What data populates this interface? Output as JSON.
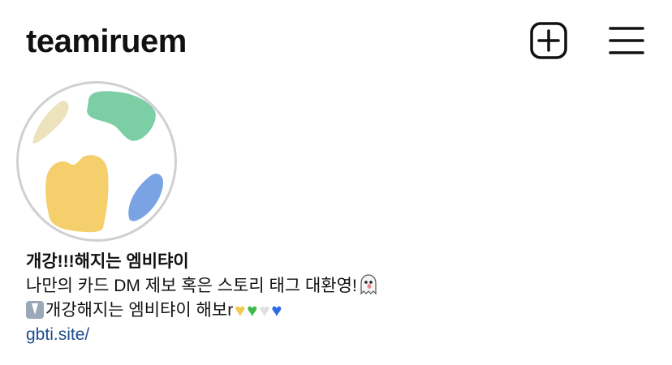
{
  "header": {
    "username": "teamiruem",
    "icons": {
      "new_post": "plus-square-icon",
      "menu": "hamburger-menu-icon"
    }
  },
  "profile": {
    "avatar_icon": "profile-avatar",
    "bio": {
      "name": "개강!!!해지는 엠비탸이",
      "line1": "나만의 카드 DM 제보 혹은 스토리 태그 대환영!",
      "line2": "개강해지는 엠비탸이 해보r",
      "link": "gbti.site/"
    }
  },
  "colors": {
    "link": "#1f4e8c",
    "heart_yellow": "#f2c94c",
    "heart_green": "#3dbb4a",
    "heart_white": "#e6e6e6",
    "heart_blue": "#2e6be6"
  }
}
